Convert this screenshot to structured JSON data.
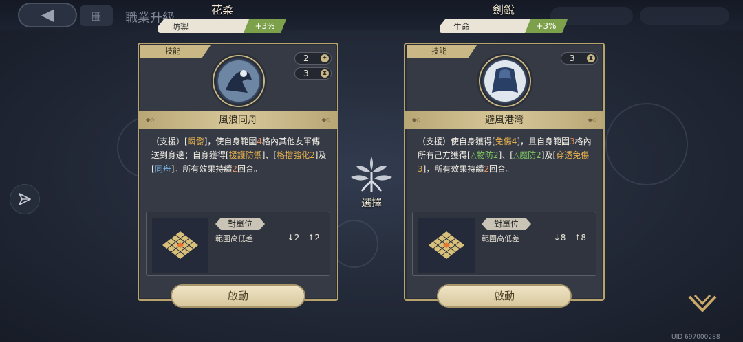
{
  "header": {
    "title": "職業升級",
    "back_icon": "back-arrow-icon",
    "grid_icon": "grid-icon"
  },
  "choose_label": "選擇",
  "uid": "UID 697000288",
  "cards": [
    {
      "char_name": "花柔",
      "stat_label": "防禦",
      "stat_value": "+3%",
      "tag": "技能",
      "badges": [
        "2",
        "3"
      ],
      "skill_name": "風浪同舟",
      "desc_parts": [
        "（支援）[",
        "瞬發",
        "]，使自身範圍",
        "4",
        "格內其他友軍傳送到身邊；自身獲得[",
        "援護防禦",
        "]、[",
        "格擋強化2",
        "]及[",
        "同舟",
        "]。所有效果持續",
        "2",
        "回合。"
      ],
      "range_tag": "對單位",
      "range_label": "範圍高低差",
      "range_value": "↓2 - ↑2",
      "activate_label": "啟動"
    },
    {
      "char_name": "劍銳",
      "stat_label": "生命",
      "stat_value": "+3%",
      "tag": "技能",
      "badges": [
        "3"
      ],
      "skill_name": "避風港灣",
      "desc_parts": [
        "（支援）使自身獲得[",
        "免傷4",
        "]，且自身範圍",
        "3",
        "格內所有己方獲得[",
        "△物防2",
        "]、[",
        "△魔防2",
        "]及[",
        "穿透免傷3",
        "]，所有效果持續",
        "2",
        "回合。"
      ],
      "range_tag": "對單位",
      "range_label": "範圍高低差",
      "range_value": "↓8 - ↑8",
      "activate_label": "啟動"
    }
  ]
}
